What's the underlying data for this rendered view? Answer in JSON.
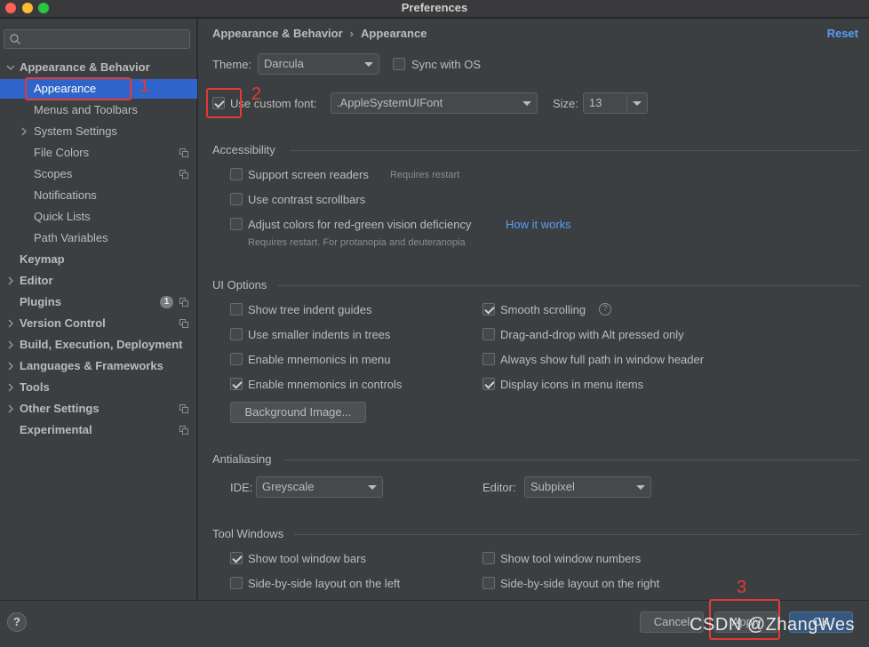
{
  "window": {
    "title": "Preferences"
  },
  "search": {
    "placeholder": ""
  },
  "sidebar": {
    "items": [
      {
        "label": "Appearance & Behavior"
      },
      {
        "label": "Appearance"
      },
      {
        "label": "Menus and Toolbars"
      },
      {
        "label": "System Settings"
      },
      {
        "label": "File Colors"
      },
      {
        "label": "Scopes"
      },
      {
        "label": "Notifications"
      },
      {
        "label": "Quick Lists"
      },
      {
        "label": "Path Variables"
      },
      {
        "label": "Keymap"
      },
      {
        "label": "Editor"
      },
      {
        "label": "Plugins",
        "badge": "1"
      },
      {
        "label": "Version Control"
      },
      {
        "label": "Build, Execution, Deployment"
      },
      {
        "label": "Languages & Frameworks"
      },
      {
        "label": "Tools"
      },
      {
        "label": "Other Settings"
      },
      {
        "label": "Experimental"
      }
    ]
  },
  "breadcrumb": {
    "parent": "Appearance & Behavior",
    "sep": "›",
    "current": "Appearance"
  },
  "reset_label": "Reset",
  "theme": {
    "label": "Theme:",
    "value": "Darcula",
    "sync_label": "Sync with OS",
    "sync_checked": false
  },
  "font": {
    "checkbox_label": "Use custom font:",
    "checked": true,
    "value": ".AppleSystemUIFont",
    "size_label": "Size:",
    "size_value": "13"
  },
  "accessibility": {
    "title": "Accessibility",
    "screen_readers": "Support screen readers",
    "screen_readers_note": "Requires restart",
    "contrast_scrollbars": "Use contrast scrollbars",
    "adjust_colors": "Adjust colors for red-green vision deficiency",
    "how_it_works": "How it works",
    "adjust_note": "Requires restart. For protanopia and deuteranopia"
  },
  "ui_options": {
    "title": "UI Options",
    "left": [
      {
        "label": "Show tree indent guides",
        "checked": false
      },
      {
        "label": "Use smaller indents in trees",
        "checked": false
      },
      {
        "label": "Enable mnemonics in menu",
        "checked": false
      },
      {
        "label": "Enable mnemonics in controls",
        "checked": true
      }
    ],
    "right": [
      {
        "label": "Smooth scrolling",
        "checked": true
      },
      {
        "label": "Drag-and-drop with Alt pressed only",
        "checked": false
      },
      {
        "label": "Always show full path in window header",
        "checked": false
      },
      {
        "label": "Display icons in menu items",
        "checked": true
      }
    ],
    "background_button": "Background Image..."
  },
  "antialiasing": {
    "title": "Antialiasing",
    "ide_label": "IDE:",
    "ide_value": "Greyscale",
    "editor_label": "Editor:",
    "editor_value": "Subpixel"
  },
  "tool_windows": {
    "title": "Tool Windows",
    "left": [
      {
        "label": "Show tool window bars",
        "checked": true
      },
      {
        "label": "Side-by-side layout on the left",
        "checked": false
      }
    ],
    "right": [
      {
        "label": "Show tool window numbers",
        "checked": false
      },
      {
        "label": "Side-by-side layout on the right",
        "checked": false
      }
    ]
  },
  "footer": {
    "help": "?",
    "cancel": "Cancel",
    "apply": "Apply",
    "ok": "OK"
  },
  "annotations": {
    "n1": "1",
    "n2": "2",
    "n3": "3",
    "watermark": "CSDN @ZhangWes"
  },
  "colors": {
    "accent": "#2f65ca",
    "link": "#589df6",
    "annotation": "#e53935"
  }
}
